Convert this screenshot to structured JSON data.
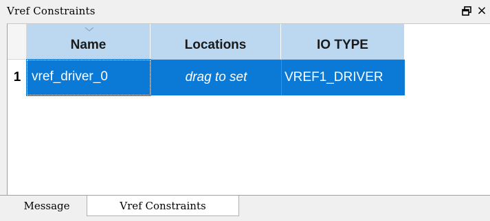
{
  "panel": {
    "title": "Vref Constraints",
    "float_icon": "float-window-icon",
    "close_icon": "close-icon",
    "float_glyph": "ʇ",
    "close_glyph": "×"
  },
  "table": {
    "columns": [
      "Name",
      "Locations",
      "IO TYPE"
    ],
    "rows": [
      {
        "index": "1",
        "name": "vref_driver_0",
        "location": "drag to set",
        "io_type": "VREF1_DRIVER"
      }
    ],
    "sorted_column": "Name",
    "colors": {
      "header_bg": "#bcd8f0",
      "selected_row_bg": "#0b7ad6",
      "selected_row_text": "#ffffff"
    }
  },
  "tabs": [
    {
      "label": "Message",
      "active": false
    },
    {
      "label": "Vref Constraints",
      "active": true
    }
  ]
}
